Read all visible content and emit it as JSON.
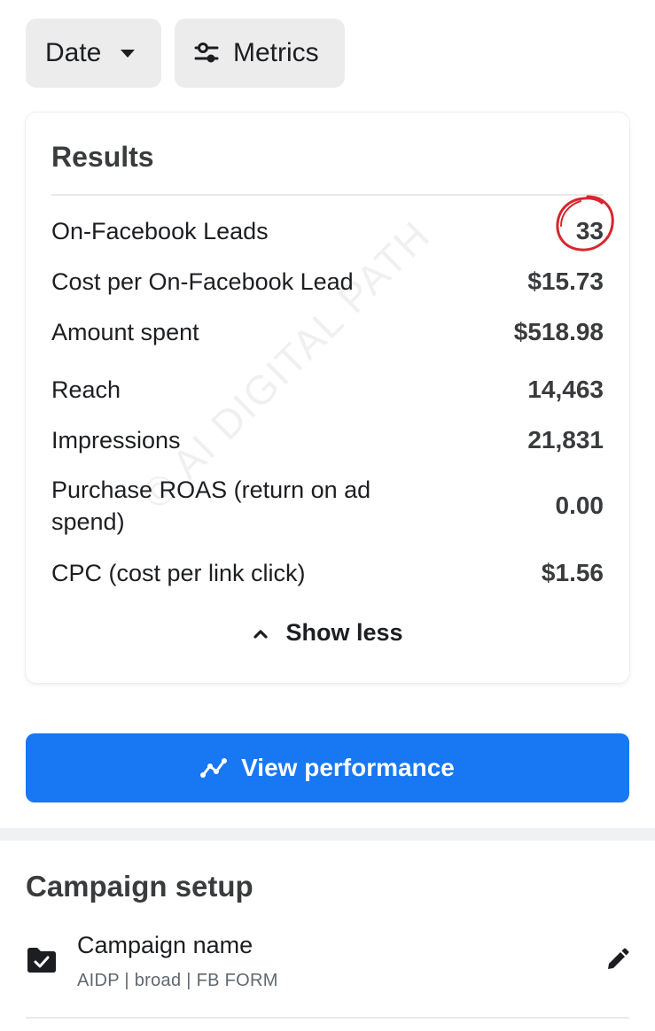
{
  "filters": {
    "date_label": "Date",
    "metrics_label": "Metrics"
  },
  "results": {
    "title": "Results",
    "rows": [
      {
        "label": "On-Facebook Leads",
        "value": "33"
      },
      {
        "label": "Cost per On-Facebook Lead",
        "value": "$15.73"
      },
      {
        "label": "Amount spent",
        "value": "$518.98"
      },
      {
        "label": "Reach",
        "value": "14,463"
      },
      {
        "label": "Impressions",
        "value": "21,831"
      },
      {
        "label": "Purchase ROAS (return on ad spend)",
        "value": "0.00"
      },
      {
        "label": "CPC (cost per link click)",
        "value": "$1.56"
      }
    ],
    "show_less_label": "Show less",
    "watermark": "© AI DIGITAL PATH"
  },
  "actions": {
    "view_performance_label": "View performance"
  },
  "campaign_setup": {
    "title": "Campaign setup",
    "item_label": "Campaign name",
    "item_value": "AIDP | broad | FB FORM"
  },
  "colors": {
    "accent": "#1877f2",
    "annotation": "#d8262e"
  },
  "icons": [
    "chevron-down-icon",
    "sliders-icon",
    "chevron-up-icon",
    "trend-line-icon",
    "folder-check-icon",
    "pencil-icon"
  ]
}
